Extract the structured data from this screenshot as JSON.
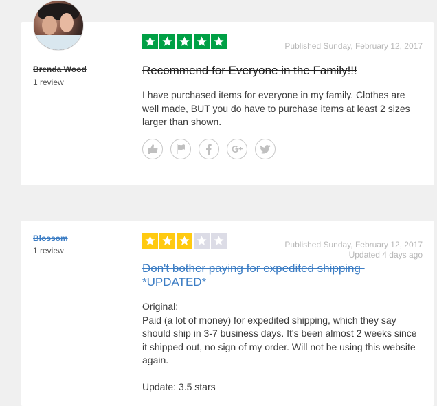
{
  "reviews": [
    {
      "reviewer": "Brenda Wood",
      "review_count": "1 review",
      "rating": 5,
      "star_color": "#00a045",
      "published": "Published Sunday, February 12, 2017",
      "updated": "",
      "title": "Recommend for Everyone in the Family!!!",
      "body": "I have purchased items for everyone in my family. Clothes are well made, BUT you do have to purchase items at least 2 sizes larger than shown.",
      "actions": [
        "like-icon",
        "flag-icon",
        "facebook-icon",
        "google-plus-icon",
        "twitter-icon"
      ]
    },
    {
      "reviewer": "Blossom",
      "review_count": "1 review",
      "rating": 3,
      "star_color": "#ffca10",
      "published": "Published Sunday, February 12, 2017",
      "updated": "Updated 4 days ago",
      "title": "Don't bother paying for expedited shipping- *UPDATED*",
      "body": "Original:\nPaid (a lot of money) for expedited shipping, which they say should ship in 3-7 business days. It's been almost 2 weeks since it shipped out, no sign of my order. Will not be using this website again.\n\nUpdate: 3.5 stars"
    }
  ],
  "colors": {
    "link_blue": "#3c7dc4",
    "empty_star": "#dcdce6",
    "name_dark": "#333333"
  }
}
